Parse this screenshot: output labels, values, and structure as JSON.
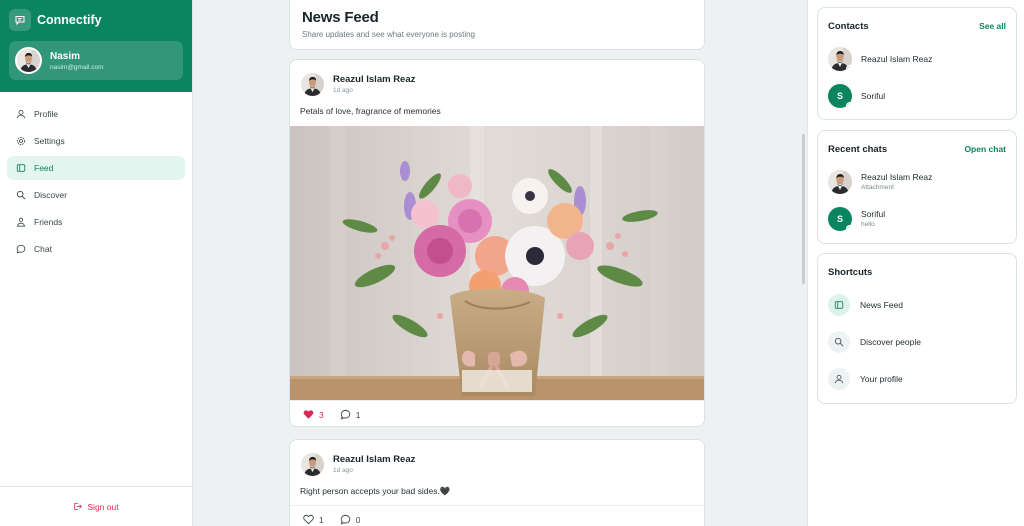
{
  "app": {
    "name": "Connectify"
  },
  "user": {
    "name": "Nasim",
    "email": "nasim@gmail.com"
  },
  "nav": [
    {
      "label": "Profile",
      "icon": "user-icon",
      "active": false
    },
    {
      "label": "Settings",
      "icon": "gear-icon",
      "active": false
    },
    {
      "label": "Feed",
      "icon": "feed-icon",
      "active": true
    },
    {
      "label": "Discover",
      "icon": "search-icon",
      "active": false
    },
    {
      "label": "Friends",
      "icon": "friends-icon",
      "active": false
    },
    {
      "label": "Chat",
      "icon": "chat-icon",
      "active": false
    }
  ],
  "signout_label": "Sign out",
  "feed": {
    "title": "News Feed",
    "subtitle": "Share updates and see what everyone is posting"
  },
  "posts": [
    {
      "author": "Reazul Islam Reaz",
      "time": "1d ago",
      "text": "Petals of love, fragrance of memories",
      "has_image": true,
      "image_alt": "flower-bouquet-photo",
      "likes": "3",
      "liked": true,
      "comments": "1"
    },
    {
      "author": "Reazul Islam Reaz",
      "time": "1d ago",
      "text": "Right person accepts your bad sides.🖤",
      "has_image": false,
      "likes": "1",
      "liked": false,
      "comments": "0"
    }
  ],
  "contacts": {
    "title": "Contacts",
    "link": "See all",
    "items": [
      {
        "name": "Reazul Islam Reaz",
        "avatar": "photo"
      },
      {
        "name": "Soriful",
        "avatar": "S"
      }
    ]
  },
  "recent_chats": {
    "title": "Recent chats",
    "link": "Open chat",
    "items": [
      {
        "name": "Reazul Islam Reaz",
        "last": "Attachment",
        "avatar": "photo"
      },
      {
        "name": "Soriful",
        "last": "hello",
        "avatar": "S"
      }
    ]
  },
  "shortcuts": {
    "title": "Shortcuts",
    "items": [
      {
        "label": "News Feed",
        "icon": "feed-icon"
      },
      {
        "label": "Discover people",
        "icon": "search-icon"
      },
      {
        "label": "Your profile",
        "icon": "user-icon"
      }
    ]
  },
  "colors": {
    "brand": "#0b8460",
    "like": "#d72a52",
    "signout": "#d3304f"
  }
}
